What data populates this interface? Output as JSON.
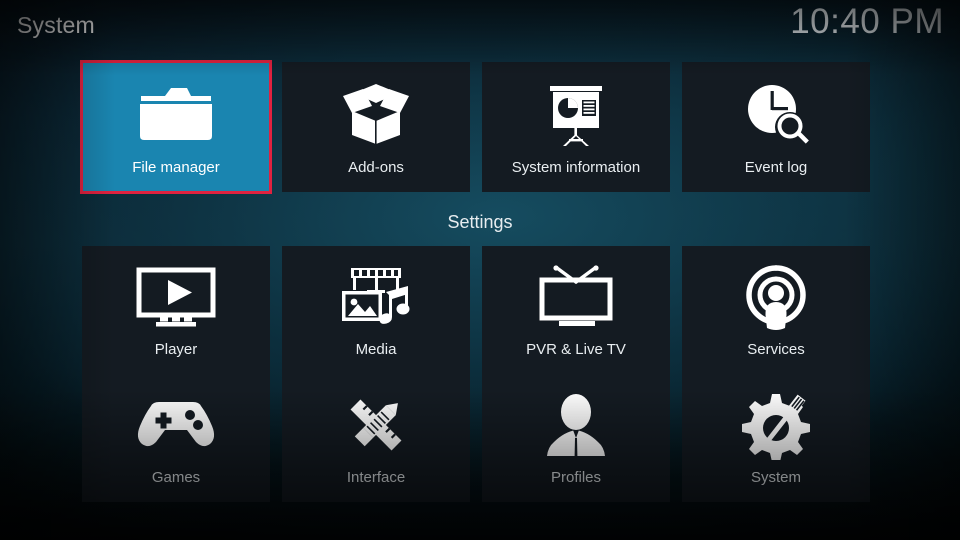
{
  "header": {
    "title": "System",
    "clock": "10:40 PM"
  },
  "section": {
    "settings_heading": "Settings"
  },
  "colors": {
    "selected_tile_bg": "#1a85b0",
    "selection_border": "#e02240",
    "tile_bg": "#141b22",
    "text": "#e9eef1",
    "background_teal": "#0c2936"
  },
  "top_row": [
    {
      "label": "File manager",
      "icon": "folder-icon",
      "selected": true
    },
    {
      "label": "Add-ons",
      "icon": "open-box-icon",
      "selected": false
    },
    {
      "label": "System information",
      "icon": "presentation-icon",
      "selected": false
    },
    {
      "label": "Event log",
      "icon": "clock-search-icon",
      "selected": false
    }
  ],
  "settings_rows": [
    [
      {
        "label": "Player",
        "icon": "monitor-play-icon",
        "selected": false
      },
      {
        "label": "Media",
        "icon": "media-library-icon",
        "selected": false
      },
      {
        "label": "PVR & Live TV",
        "icon": "tv-antenna-icon",
        "selected": false
      },
      {
        "label": "Services",
        "icon": "broadcast-user-icon",
        "selected": false
      }
    ],
    [
      {
        "label": "Games",
        "icon": "gamepad-icon",
        "selected": false
      },
      {
        "label": "Interface",
        "icon": "pencil-ruler-icon",
        "selected": false
      },
      {
        "label": "Profiles",
        "icon": "user-bust-icon",
        "selected": false
      },
      {
        "label": "System",
        "icon": "gear-wrench-icon",
        "selected": false
      }
    ]
  ]
}
